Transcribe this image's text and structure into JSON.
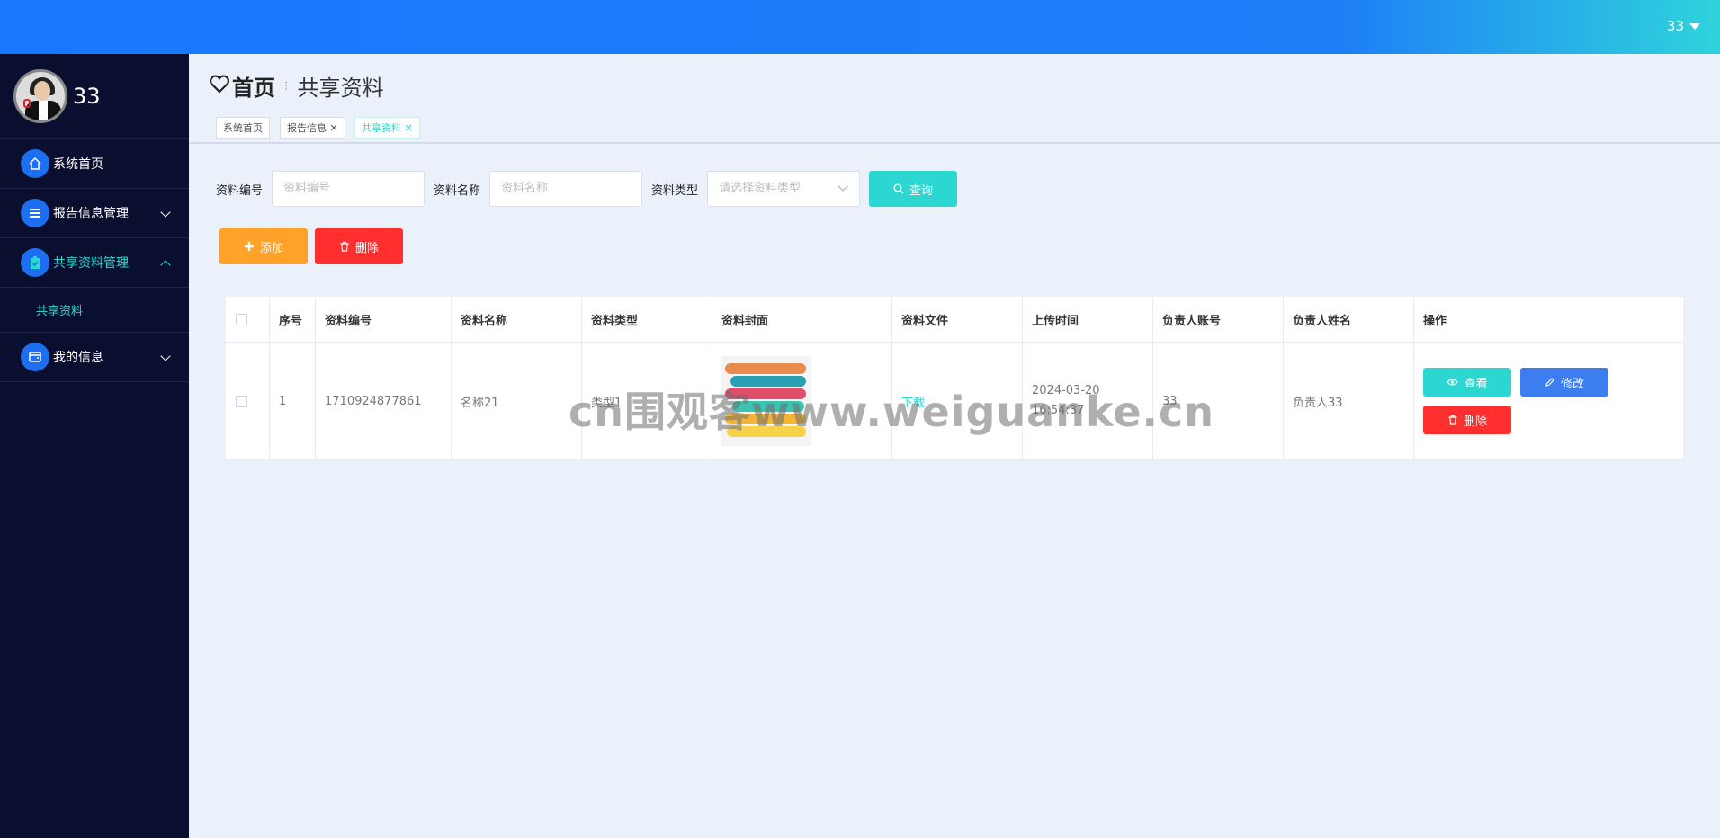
{
  "topbar": {
    "user_label": "33"
  },
  "sidebar": {
    "user_name": "33",
    "items": [
      {
        "label": "系统首页",
        "icon": "home-icon"
      },
      {
        "label": "报告信息管理",
        "icon": "list-icon"
      },
      {
        "label": "共享资料管理",
        "icon": "clipboard-icon"
      },
      {
        "label": "我的信息",
        "icon": "wallet-icon"
      }
    ],
    "sub_items": [
      {
        "label": "共享资料"
      }
    ]
  },
  "breadcrumb": {
    "home": "首页",
    "current": "共享资料"
  },
  "tags": [
    {
      "label": "系统首页"
    },
    {
      "label": "报告信息"
    },
    {
      "label": "共享资料"
    }
  ],
  "search": {
    "no_label": "资料编号",
    "no_placeholder": "资料编号",
    "name_label": "资料名称",
    "name_placeholder": "资料名称",
    "type_label": "资料类型",
    "type_placeholder": "请选择资料类型",
    "query_label": "查询"
  },
  "actions": {
    "add_label": "添加",
    "delete_label": "删除"
  },
  "table": {
    "headers": [
      "序号",
      "资料编号",
      "资料名称",
      "资料类型",
      "资料封面",
      "资料文件",
      "上传时间",
      "负责人账号",
      "负责人姓名",
      "操作"
    ],
    "rows": [
      {
        "index": "1",
        "no": "1710924877861",
        "name": "名称21",
        "type": "类型1",
        "file": "下载",
        "time": "2024-03-20 16:54:37",
        "account": "33",
        "owner": "负责人33",
        "view_label": "查看",
        "edit_label": "修改",
        "delete_label": "删除"
      }
    ]
  },
  "watermark": "cn围观客www.weiguanke.cn",
  "colors": {
    "primary": "#1877ff",
    "accent": "#2bd7d0",
    "warning": "#ffa22a",
    "danger": "#ff2f2f",
    "sidebar": "#0b0f2f"
  }
}
